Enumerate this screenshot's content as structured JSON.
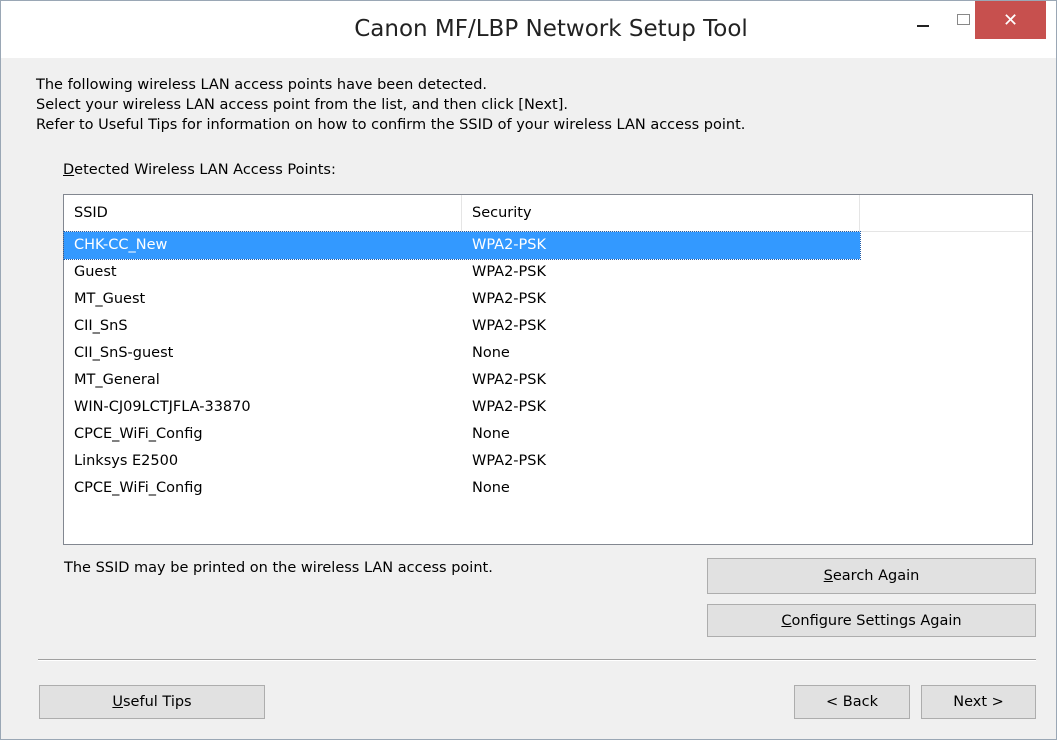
{
  "window": {
    "title": "Canon MF/LBP Network Setup Tool",
    "close_glyph": "✕"
  },
  "instructions": [
    "The following wireless LAN access points have been detected.",
    "Select your wireless LAN access point from the list, and then click [Next].",
    "Refer to Useful Tips for information on how to confirm the SSID of your wireless LAN access point."
  ],
  "list": {
    "caption_first": "D",
    "caption_rest": "etected Wireless LAN Access Points:",
    "columns": [
      "SSID",
      "Security"
    ],
    "rows": [
      {
        "ssid": "CHK-CC_New",
        "security": "WPA2-PSK",
        "selected": true
      },
      {
        "ssid": "Guest",
        "security": "WPA2-PSK"
      },
      {
        "ssid": "MT_Guest",
        "security": "WPA2-PSK"
      },
      {
        "ssid": "CII_SnS",
        "security": "WPA2-PSK"
      },
      {
        "ssid": "CII_SnS-guest",
        "security": "None"
      },
      {
        "ssid": "MT_General",
        "security": "WPA2-PSK"
      },
      {
        "ssid": "WIN-CJ09LCTJFLA-33870",
        "security": "WPA2-PSK"
      },
      {
        "ssid": "CPCE_WiFi_Config",
        "security": "None"
      },
      {
        "ssid": "Linksys E2500",
        "security": "WPA2-PSK"
      },
      {
        "ssid": "CPCE_WiFi_Config",
        "security": "None"
      }
    ]
  },
  "ssid_hint": "The SSID may be printed on the wireless LAN access point.",
  "buttons": {
    "search_again": {
      "mnemonic": "S",
      "rest": "earch Again"
    },
    "configure_again": {
      "mnemonic": "C",
      "rest": "onfigure Settings Again"
    },
    "useful_tips": {
      "mnemonic": "U",
      "rest": "seful Tips"
    },
    "back": "< Back",
    "next": "Next >"
  }
}
